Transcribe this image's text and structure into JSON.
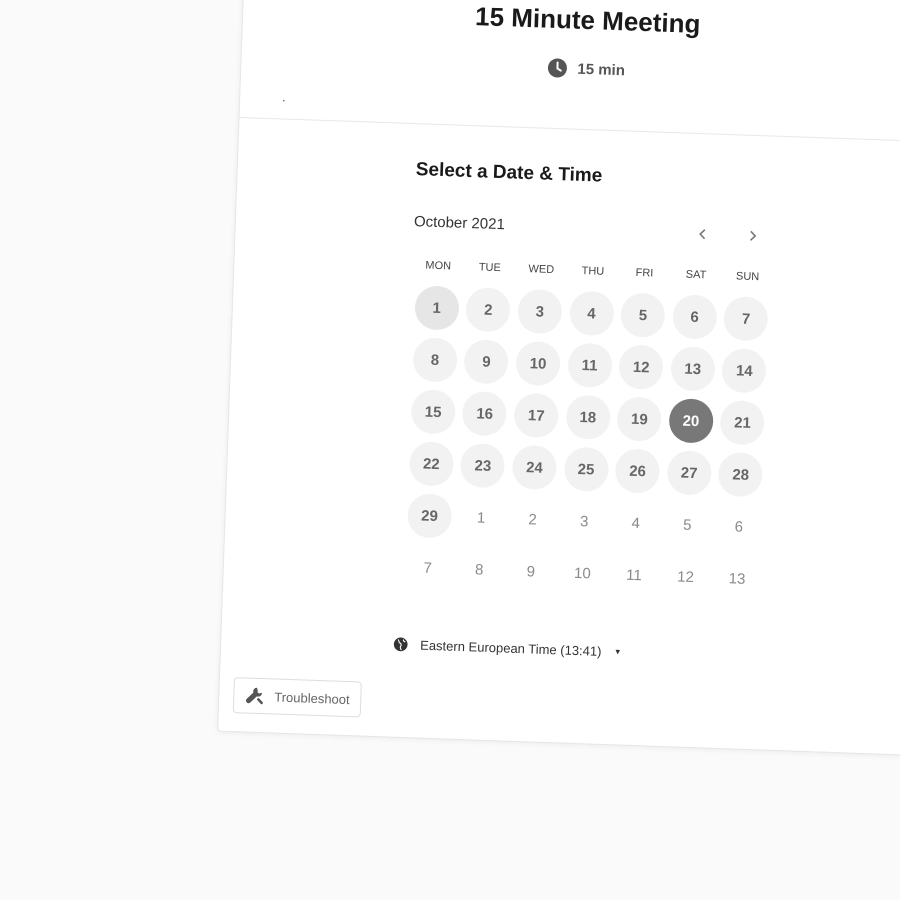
{
  "header": {
    "title": "15 Minute Meeting",
    "duration": "15 min",
    "dot": "."
  },
  "calendar": {
    "section_title": "Select a Date & Time",
    "month_label": "October 2021",
    "prev_icon": "chevron-left-icon",
    "next_icon": "chevron-right-icon",
    "weekdays": [
      "MON",
      "TUE",
      "WED",
      "THU",
      "FRI",
      "SAT",
      "SUN"
    ],
    "days": [
      {
        "label": "1",
        "state": "available-first"
      },
      {
        "label": "2",
        "state": "available"
      },
      {
        "label": "3",
        "state": "available"
      },
      {
        "label": "4",
        "state": "available"
      },
      {
        "label": "5",
        "state": "available"
      },
      {
        "label": "6",
        "state": "available"
      },
      {
        "label": "7",
        "state": "available"
      },
      {
        "label": "8",
        "state": "available"
      },
      {
        "label": "9",
        "state": "available"
      },
      {
        "label": "10",
        "state": "available"
      },
      {
        "label": "11",
        "state": "available"
      },
      {
        "label": "12",
        "state": "available"
      },
      {
        "label": "13",
        "state": "available"
      },
      {
        "label": "14",
        "state": "available"
      },
      {
        "label": "15",
        "state": "available"
      },
      {
        "label": "16",
        "state": "available"
      },
      {
        "label": "17",
        "state": "available"
      },
      {
        "label": "18",
        "state": "available"
      },
      {
        "label": "19",
        "state": "available"
      },
      {
        "label": "20",
        "state": "selected"
      },
      {
        "label": "21",
        "state": "available"
      },
      {
        "label": "22",
        "state": "available"
      },
      {
        "label": "23",
        "state": "available"
      },
      {
        "label": "24",
        "state": "available"
      },
      {
        "label": "25",
        "state": "available"
      },
      {
        "label": "26",
        "state": "available"
      },
      {
        "label": "27",
        "state": "available"
      },
      {
        "label": "28",
        "state": "available"
      },
      {
        "label": "29",
        "state": "available"
      },
      {
        "label": "1",
        "state": "other"
      },
      {
        "label": "2",
        "state": "other"
      },
      {
        "label": "3",
        "state": "other"
      },
      {
        "label": "4",
        "state": "other"
      },
      {
        "label": "5",
        "state": "other"
      },
      {
        "label": "6",
        "state": "other"
      },
      {
        "label": "7",
        "state": "other"
      },
      {
        "label": "8",
        "state": "other"
      },
      {
        "label": "9",
        "state": "other"
      },
      {
        "label": "10",
        "state": "other"
      },
      {
        "label": "11",
        "state": "other"
      },
      {
        "label": "12",
        "state": "other"
      },
      {
        "label": "13",
        "state": "other"
      }
    ]
  },
  "timezone": {
    "label": "Eastern European Time (13:41)",
    "icon": "globe-icon",
    "caret": "▾"
  },
  "troubleshoot": {
    "label": "Troubleshoot",
    "icon": "wrench-icon"
  },
  "colors": {
    "page_bg": "#fafafa",
    "card_bg": "#ffffff",
    "day_bg": "#f2f2f2",
    "selected_bg": "#787878",
    "text_dark": "#1a1a1a",
    "text_muted": "#666666"
  }
}
